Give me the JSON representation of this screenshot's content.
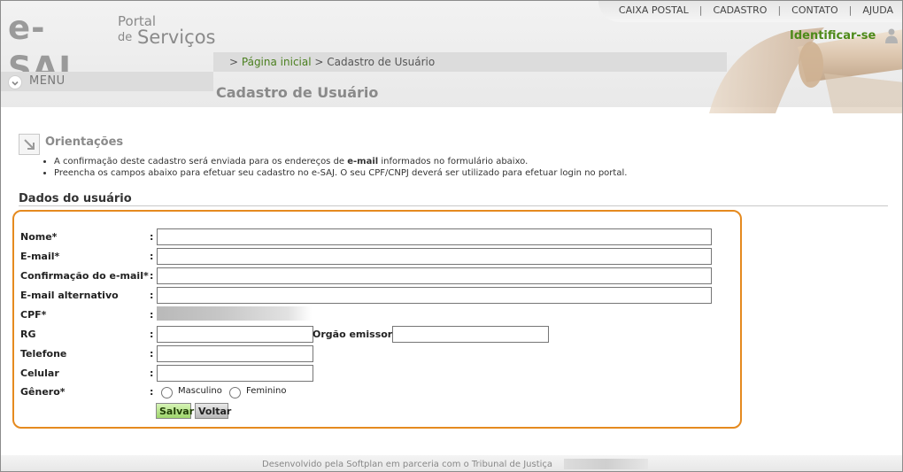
{
  "logo": {
    "esaj": "e-SAJ",
    "portal": "Portal",
    "de": "de",
    "servicos": "Serviços"
  },
  "topnav": [
    "CAIXA POSTAL",
    "CADASTRO",
    "CONTATO",
    "AJUDA"
  ],
  "topnav_separator": "|",
  "identify_label": "Identificar-se",
  "breadcrumb": {
    "prefix": ">",
    "home": "Página inicial",
    "sep": ">",
    "current": "Cadastro de Usuário"
  },
  "menu_label": "MENU",
  "page_title": "Cadastro de Usuário",
  "orientations": {
    "title": "Orientações",
    "items": [
      {
        "before": "A confirmação deste cadastro será enviada para os endereços de ",
        "bold": "e-mail",
        "after": " informados no formulário abaixo."
      },
      {
        "before": "Preencha os campos abaixo para efetuar seu cadastro no e-SAJ. O seu CPF/CNPJ deverá ser utilizado para efetuar login no portal.",
        "bold": "",
        "after": ""
      }
    ]
  },
  "section_title": "Dados do usuário",
  "form": {
    "colon": ":",
    "nome": {
      "label": "Nome*",
      "value": ""
    },
    "email": {
      "label": "E-mail*",
      "value": ""
    },
    "email_confirm": {
      "label": "Confirmação do e-mail*",
      "value": ""
    },
    "email_alt": {
      "label": "E-mail alternativo",
      "value": ""
    },
    "cpf": {
      "label": "CPF*"
    },
    "rg": {
      "label": "RG",
      "value": ""
    },
    "orgao": {
      "label": "Orgão emissor:",
      "value": ""
    },
    "telefone": {
      "label": "Telefone",
      "value": ""
    },
    "celular": {
      "label": "Celular",
      "value": ""
    },
    "genero": {
      "label": "Gênero*",
      "options": [
        "Masculino",
        "Feminino"
      ]
    },
    "save_label": "Salvar",
    "back_label": "Voltar"
  },
  "footer_text": "Desenvolvido pela Softplan em parceria com o Tribunal de Justiça",
  "colors": {
    "accent_green": "#4d8a19",
    "highlight_orange": "#e58a1f"
  }
}
